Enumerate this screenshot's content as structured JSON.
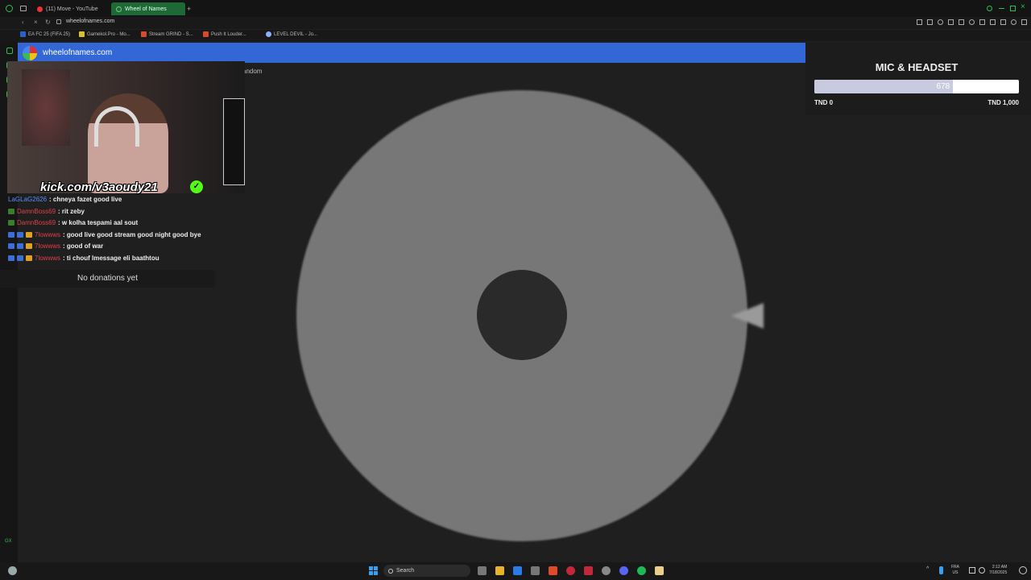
{
  "browser": {
    "tabs": [
      {
        "label": "(11) Move - YouTube"
      },
      {
        "label": "Wheel of Names"
      }
    ],
    "url": "wheelofnames.com",
    "bookmarks": [
      {
        "label": "EA FC 25 (FIFA 25)"
      },
      {
        "label": "Gamekol.Pro - Mo..."
      },
      {
        "label": "Stream GRIND - S..."
      },
      {
        "label": "Push It Louder..."
      },
      {
        "label": "LEVEL DEVIL - Jo..."
      }
    ]
  },
  "site": {
    "title": "wheelofnames.com",
    "random_partial": "andom"
  },
  "stream": {
    "kick_link": "kick.com/v3aoudy21",
    "chat": [
      {
        "user": "LaGLaG2626",
        "message": ": chneya fazet good live",
        "user_color": "#5b8cff"
      },
      {
        "user": "DamnBoss69",
        "message": ": rit zeby",
        "user_color": "#e0404a"
      },
      {
        "user": "DamnBoss69",
        "message": ": w kolha tespami aal sout",
        "user_color": "#e0404a"
      },
      {
        "user": "7lowwws",
        "message": ": good live good stream good night good bye",
        "user_color": "#e0404a"
      },
      {
        "user": "7lowwws",
        "message": ": good of war",
        "user_color": "#e0404a"
      },
      {
        "user": "7lowwws",
        "message": ": ti chouf lmessage eli baathtou",
        "user_color": "#e0404a"
      }
    ],
    "donations_text": "No donations yet"
  },
  "goal": {
    "title": "MIC & HEADSET",
    "current": "678",
    "progress_fraction": 0.678,
    "min_label": "TND 0",
    "max_label": "TND 1,000"
  },
  "taskbar": {
    "search_placeholder": "Search",
    "lang": "FRA",
    "region": "US",
    "time": "2:12 AM",
    "date": "7/18/2025"
  },
  "colors": {
    "header_blue": "#3367d6",
    "kick_green": "#53fc18",
    "tab_active": "#1d6a36"
  }
}
